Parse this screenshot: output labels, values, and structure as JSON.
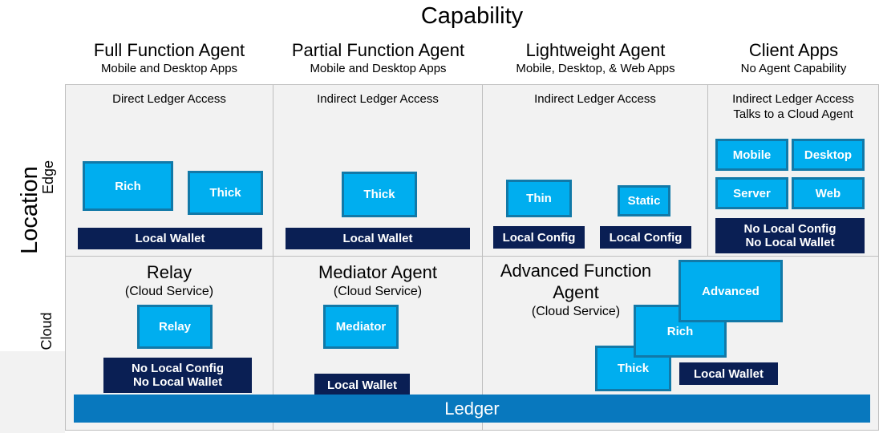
{
  "axes": {
    "x_title": "Capability",
    "y_title": "Location",
    "rows": [
      {
        "key": "edge",
        "label": "Edge"
      },
      {
        "key": "cloud",
        "label": "Cloud"
      }
    ]
  },
  "colors": {
    "agent_fill": "#00AEEF",
    "agent_border": "#1179A8",
    "store_fill": "#0A1F54",
    "ledger_fill": "#0878BE",
    "cell_bg": "#f2f2f2",
    "grid_line": "#bfbfbf"
  },
  "columns": [
    {
      "title": "Full Function Agent",
      "subtitle": "Mobile and Desktop Apps"
    },
    {
      "title": "Partial Function Agent",
      "subtitle": "Mobile and Desktop Apps"
    },
    {
      "title": "Lightweight Agent",
      "subtitle": "Mobile, Desktop, & Web Apps"
    },
    {
      "title": "Client Apps",
      "subtitle": "No Agent Capability"
    }
  ],
  "edge_row": {
    "cells": [
      {
        "access": "Direct Ledger Access",
        "agents": [
          {
            "label": "Rich"
          },
          {
            "label": "Thick"
          }
        ],
        "store": {
          "label": "Local Wallet"
        }
      },
      {
        "access": "Indirect Ledger Access",
        "agents": [
          {
            "label": "Thick"
          }
        ],
        "store": {
          "label": "Local Wallet"
        }
      },
      {
        "access": "Indirect Ledger Access",
        "agents": [
          {
            "label": "Thin"
          },
          {
            "label": "Static"
          }
        ],
        "stores": [
          {
            "label": "Local Config"
          },
          {
            "label": "Local Config"
          }
        ]
      },
      {
        "access_line1": "Indirect Ledger Access",
        "access_line2": "Talks to a Cloud Agent",
        "agents": [
          {
            "label": "Mobile"
          },
          {
            "label": "Desktop"
          },
          {
            "label": "Server"
          },
          {
            "label": "Web"
          }
        ],
        "store": {
          "line1": "No Local Config",
          "line2": "No Local Wallet"
        }
      }
    ]
  },
  "cloud_row": {
    "cells": [
      {
        "name": "Relay",
        "subtitle": "(Cloud Service)",
        "agents": [
          {
            "label": "Relay"
          }
        ],
        "store": {
          "line1": "No Local Config",
          "line2": "No Local Wallet"
        }
      },
      {
        "name": "Mediator Agent",
        "subtitle": "(Cloud Service)",
        "agents": [
          {
            "label": "Mediator"
          }
        ],
        "store": {
          "label": "Local Wallet"
        }
      },
      {
        "name_line1": "Advanced Function",
        "name_line2": "Agent",
        "subtitle": "(Cloud Service)",
        "agents": [
          {
            "label": "Advanced"
          },
          {
            "label": "Rich"
          },
          {
            "label": "Thick"
          }
        ],
        "store": {
          "label": "Local Wallet"
        }
      }
    ]
  },
  "ledger": {
    "label": "Ledger"
  }
}
